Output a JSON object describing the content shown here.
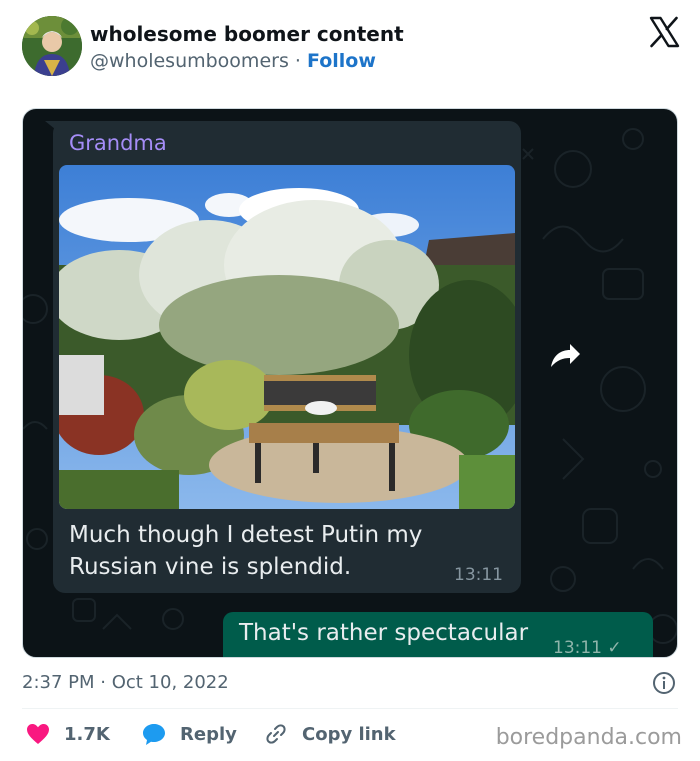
{
  "header": {
    "display_name": "wholesome boomer content",
    "handle": "@wholesumboomers",
    "separator": "·",
    "follow_label": "Follow"
  },
  "chat": {
    "incoming": {
      "sender": "Grandma",
      "photo_icon": "garden-photo-image",
      "text": "Much though I detest Putin my Russian vine is splendid.",
      "time": "13:11"
    },
    "forward_icon": "forward-arrow-icon",
    "outgoing": {
      "text": "That's rather spectacular",
      "time": "13:11",
      "status": "✓"
    }
  },
  "meta": {
    "timestamp": "2:37 PM · Oct 10, 2022"
  },
  "actions": {
    "likes": "1.7K",
    "reply_label": "Reply",
    "copy_label": "Copy link"
  },
  "watermark": "boredpanda.com",
  "colors": {
    "like": "#f91880",
    "reply": "#1d9bf0",
    "follow": "#1d74c9",
    "chat_bg": "#0c1317",
    "incoming_bubble": "#202c33",
    "outgoing_bubble": "#005c4b",
    "sender_name": "#a58df7"
  }
}
